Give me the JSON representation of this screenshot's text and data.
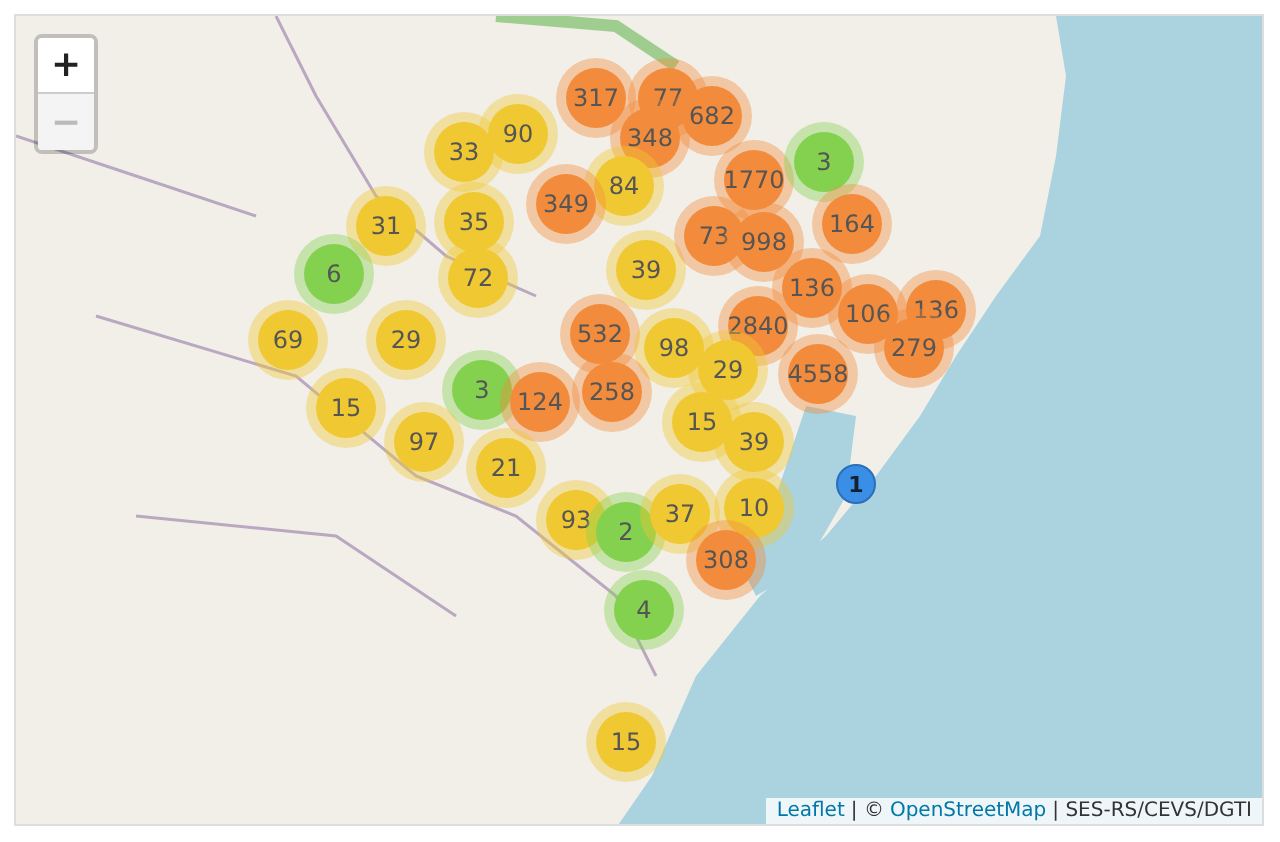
{
  "zoom_control": {
    "buttons": [
      {
        "label": "+",
        "disabled": false
      },
      {
        "label": "−",
        "disabled": true
      }
    ]
  },
  "markers": [
    {
      "kind": "cluster",
      "count": "317",
      "color": "#f28c3c"
    },
    {
      "kind": "cluster",
      "count": "77",
      "color": "#f28c3c"
    },
    {
      "kind": "cluster",
      "count": "682",
      "color": "#f28c3c"
    },
    {
      "kind": "cluster",
      "count": "348",
      "color": "#f28c3c"
    },
    {
      "kind": "cluster",
      "count": "33",
      "color": "#f0c832"
    },
    {
      "kind": "cluster",
      "count": "90",
      "color": "#f0c832"
    },
    {
      "kind": "cluster",
      "count": "84",
      "color": "#f0c832"
    },
    {
      "kind": "cluster",
      "count": "349",
      "color": "#f28c3c"
    },
    {
      "kind": "cluster",
      "count": "1770",
      "color": "#f28c3c"
    },
    {
      "kind": "cluster",
      "count": "3",
      "color": "#84d14f"
    },
    {
      "kind": "cluster",
      "count": "31",
      "color": "#f0c832"
    },
    {
      "kind": "cluster",
      "count": "35",
      "color": "#f0c832"
    },
    {
      "kind": "cluster",
      "count": "6",
      "color": "#84d14f"
    },
    {
      "kind": "cluster",
      "count": "72",
      "color": "#f0c832"
    },
    {
      "kind": "cluster",
      "count": "39",
      "color": "#f0c832"
    },
    {
      "kind": "cluster",
      "count": "73",
      "color": "#f28c3c"
    },
    {
      "kind": "cluster",
      "count": "998",
      "color": "#f28c3c"
    },
    {
      "kind": "cluster",
      "count": "164",
      "color": "#f28c3c"
    },
    {
      "kind": "cluster",
      "count": "136",
      "color": "#f28c3c"
    },
    {
      "kind": "cluster",
      "count": "106",
      "color": "#f28c3c"
    },
    {
      "kind": "cluster",
      "count": "136",
      "color": "#f28c3c"
    },
    {
      "kind": "cluster",
      "count": "69",
      "color": "#f0c832"
    },
    {
      "kind": "cluster",
      "count": "29",
      "color": "#f0c832"
    },
    {
      "kind": "cluster",
      "count": "532",
      "color": "#f28c3c"
    },
    {
      "kind": "cluster",
      "count": "98",
      "color": "#f0c832"
    },
    {
      "kind": "cluster",
      "count": "2840",
      "color": "#f28c3c"
    },
    {
      "kind": "cluster",
      "count": "29",
      "color": "#f0c832"
    },
    {
      "kind": "cluster",
      "count": "279",
      "color": "#f28c3c"
    },
    {
      "kind": "cluster",
      "count": "4558",
      "color": "#f28c3c"
    },
    {
      "kind": "cluster",
      "count": "3",
      "color": "#84d14f"
    },
    {
      "kind": "cluster",
      "count": "124",
      "color": "#f28c3c"
    },
    {
      "kind": "cluster",
      "count": "258",
      "color": "#f28c3c"
    },
    {
      "kind": "cluster",
      "count": "15",
      "color": "#f0c832"
    },
    {
      "kind": "cluster",
      "count": "97",
      "color": "#f0c832"
    },
    {
      "kind": "cluster",
      "count": "15",
      "color": "#f0c832"
    },
    {
      "kind": "cluster",
      "count": "39",
      "color": "#f0c832"
    },
    {
      "kind": "cluster",
      "count": "21",
      "color": "#f0c832"
    },
    {
      "kind": "point",
      "count": "1",
      "color": "#3a8ee6"
    },
    {
      "kind": "cluster",
      "count": "93",
      "color": "#f0c832"
    },
    {
      "kind": "cluster",
      "count": "2",
      "color": "#84d14f"
    },
    {
      "kind": "cluster",
      "count": "37",
      "color": "#f0c832"
    },
    {
      "kind": "cluster",
      "count": "10",
      "color": "#f0c832"
    },
    {
      "kind": "cluster",
      "count": "308",
      "color": "#f28c3c"
    },
    {
      "kind": "cluster",
      "count": "4",
      "color": "#84d14f"
    },
    {
      "kind": "cluster",
      "count": "15",
      "color": "#f0c832"
    }
  ],
  "attribution": {
    "leaflet_link": "Leaflet",
    "copyright": "| ©",
    "osm_link": "OpenStreetMap",
    "credit": "| SES-RS/CEVS/DGTI"
  }
}
